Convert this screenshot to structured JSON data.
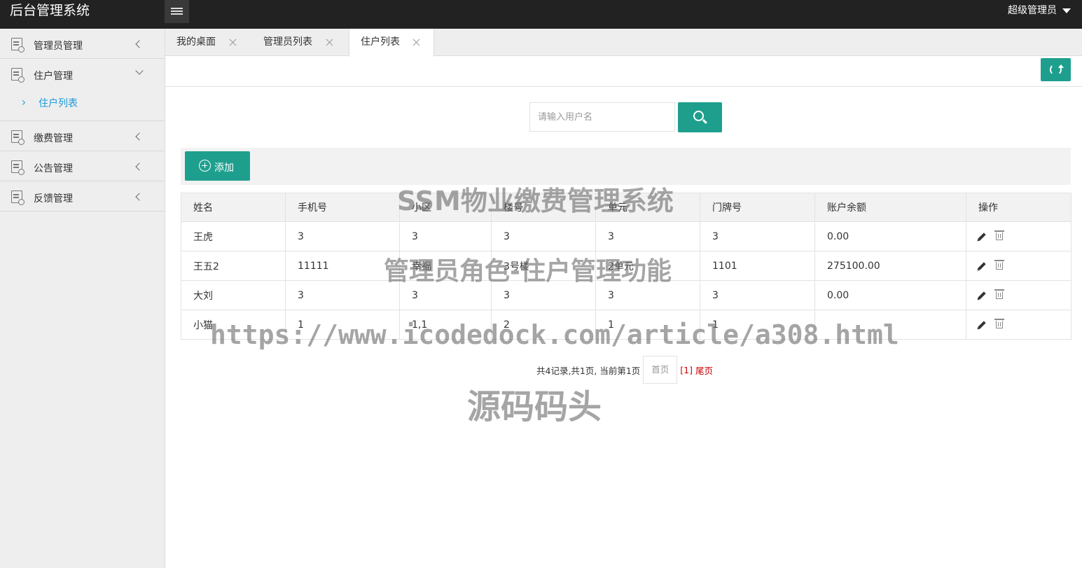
{
  "header": {
    "app_title": "后台管理系统",
    "user_name": "超级管理员"
  },
  "sidebar": {
    "groups": [
      {
        "label": "管理员管理",
        "expanded": false
      },
      {
        "label": "住户管理",
        "expanded": true,
        "children": [
          {
            "label": "住户列表",
            "active": true
          }
        ]
      },
      {
        "label": "缴费管理",
        "expanded": false
      },
      {
        "label": "公告管理",
        "expanded": false
      },
      {
        "label": "反馈管理",
        "expanded": false
      }
    ]
  },
  "tabs": [
    {
      "label": "我的桌面",
      "active": false
    },
    {
      "label": "管理员列表",
      "active": false
    },
    {
      "label": "住户列表",
      "active": true
    }
  ],
  "search": {
    "placeholder": "请输入用户名",
    "value": ""
  },
  "actions": {
    "add_label": "添加"
  },
  "table": {
    "columns": [
      "姓名",
      "手机号",
      "小区",
      "楼号",
      "单元",
      "门牌号",
      "账户余额",
      "操作"
    ],
    "rows": [
      [
        "王虎",
        "3",
        "3",
        "3",
        "3",
        "3",
        "0.00"
      ],
      [
        "王五2",
        "11111",
        "幸福",
        "3号楼",
        "2单元",
        "1101",
        "275100.00"
      ],
      [
        "大刘",
        "3",
        "3",
        "3",
        "3",
        "3",
        "0.00"
      ],
      [
        "小猫",
        "1",
        "1,1",
        "2",
        "1",
        "1",
        ""
      ]
    ]
  },
  "pagination": {
    "summary": "共4记录,共1页, 当前第1页",
    "first_label": "首页",
    "current_label": "[1]",
    "last_label": "尾页"
  },
  "watermarks": {
    "line1": "SSM物业缴费管理系统",
    "line2": "管理员角色-住户管理功能",
    "line3": "https://www.icodedock.com/article/a308.html",
    "line4": "源码码头"
  },
  "colors": {
    "primary": "#1e9f8e",
    "topbar": "#222222",
    "sidebar_bg": "#eeeeee",
    "link_active": "#1a9ad6",
    "pager_accent": "#cc0000"
  }
}
